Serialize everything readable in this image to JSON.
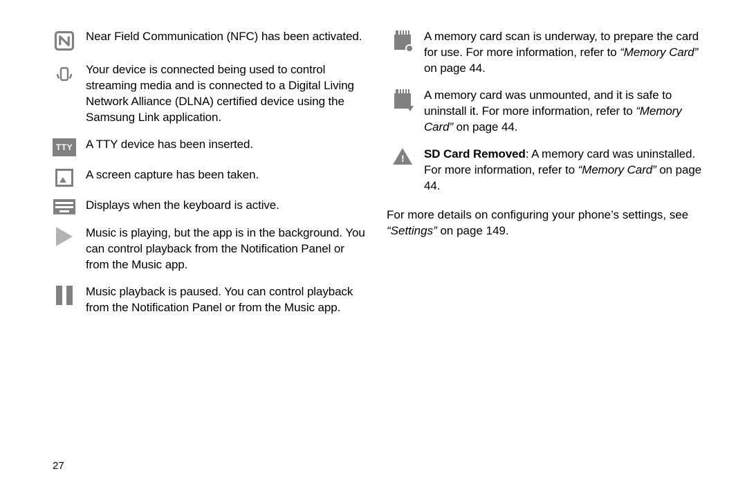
{
  "page_number": "27",
  "left": [
    {
      "desc": "Near Field Communication (NFC) has been activated."
    },
    {
      "desc": "Your device is connected being used to control streaming media and is connected to a Digital Living Network Alliance (DLNA) certified device using the Samsung Link application."
    },
    {
      "desc": "A TTY device has been inserted.",
      "tty_label": "TTY"
    },
    {
      "desc": "A screen capture has been taken."
    },
    {
      "desc": "Displays when the keyboard is active."
    },
    {
      "desc": "Music is playing, but the app is in the background. You can control playback from the Notification Panel or from the Music app."
    },
    {
      "desc": "Music playback is paused. You can control playback from the Notification Panel or from the Music app."
    }
  ],
  "right": [
    {
      "desc": "A memory card scan is underway, to prepare the card for use. For more information, refer to ",
      "ref_italic": "“Memory Card”",
      "ref_tail": " on page 44."
    },
    {
      "desc": "A memory card was unmounted, and it is safe to uninstall it. For more information, refer to ",
      "ref_italic": "“Memory Card”",
      "ref_tail": " on page 44."
    },
    {
      "bold_lead": "SD Card Removed",
      "desc": ": A memory card was uninstalled. For more information, refer to ",
      "ref_italic": "“Memory Card”",
      "ref_tail": " on page 44."
    }
  ],
  "footer": {
    "lead": "For more details on configuring your phone’s settings, see ",
    "ref_italic": "“Settings”",
    "ref_tail": " on page 149."
  }
}
